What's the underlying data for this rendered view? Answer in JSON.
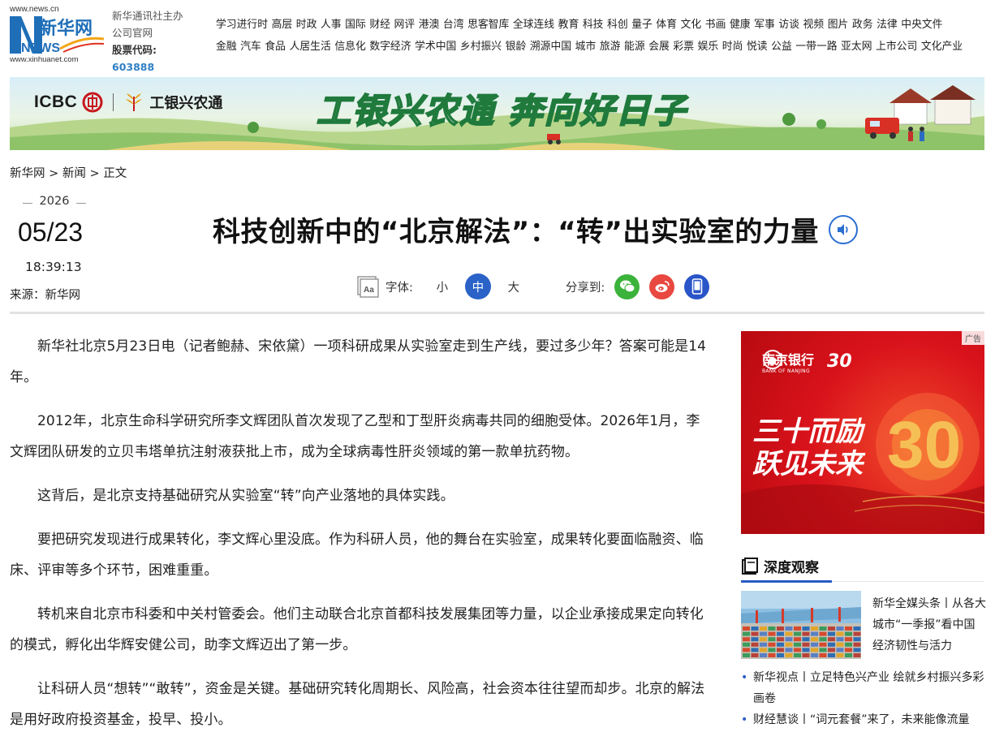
{
  "header": {
    "site_url": "www.news.cn",
    "site_url_alt": "www.xinhuanet.com",
    "logo_cn": "新华网",
    "logo_en": "NEWS",
    "host_line1": "新华通讯社主办",
    "host_line2": "公司官网",
    "stock_label": "股票代码:",
    "stock_code": "603888",
    "nav_row1": [
      "学习进行时",
      "高层",
      "时政",
      "人事",
      "国际",
      "财经",
      "网评",
      "港澳",
      "台湾",
      "思客智库",
      "全球连线",
      "教育",
      "科技",
      "科创",
      "量子",
      "体育",
      "文化",
      "书画",
      "健康",
      "军事",
      "访谈",
      "视频",
      "图片",
      "政务",
      "法律",
      "中央文件"
    ],
    "nav_row2": [
      "金融",
      "汽车",
      "食品",
      "人居生活",
      "信息化",
      "数字经济",
      "学术中国",
      "乡村振兴",
      "银龄",
      "溯源中国",
      "城市",
      "旅游",
      "能源",
      "会展",
      "彩票",
      "娱乐",
      "时尚",
      "悦读",
      "公益",
      "一带一路",
      "亚太网",
      "上市公司",
      "文化产业"
    ]
  },
  "banner": {
    "brand": "ICBC",
    "brand_cn": "工银兴农通",
    "slogan": "工银兴农通 奔向好日子"
  },
  "breadcrumb": {
    "home": "新华网",
    "sep1": " > ",
    "section": "新闻",
    "sep2": " > ",
    "current": "正文"
  },
  "meta": {
    "year": "2026",
    "monthday": "05/23",
    "time": "18:39:13",
    "source": "来源：新华网"
  },
  "article": {
    "title": "科技创新中的“北京解法”：“转”出实验室的力量",
    "font_label": "字体:",
    "font_small": "小",
    "font_medium": "中",
    "font_large": "大",
    "share_label": "分享到:",
    "paragraphs": [
      "新华社北京5月23日电（记者鲍赫、宋依黛）一项科研成果从实验室走到生产线，要过多少年？答案可能是14年。",
      "2012年，北京生命科学研究所李文辉团队首次发现了乙型和丁型肝炎病毒共同的细胞受体。2026年1月，李文辉团队研发的立贝韦塔单抗注射液获批上市，成为全球病毒性肝炎领域的第一款单抗药物。",
      "这背后，是北京支持基础研究从实验室“转”向产业落地的具体实践。",
      "要把研究发现进行成果转化，李文辉心里没底。作为科研人员，他的舞台在实验室，成果转化要面临融资、临床、评审等多个环节，困难重重。",
      "转机来自北京市科委和中关村管委会。他们主动联合北京首都科技发展集团等力量，以企业承接成果定向转化的模式，孵化出华辉安健公司，助李文辉迈出了第一步。",
      "让科研人员“想转”“敢转”，资金是关键。基础研究转化周期长、风险高，社会资本往往望而却步。北京的解法是用好政府投资基金，投早、投小。"
    ]
  },
  "sidebar": {
    "ad_tag": "广告",
    "ad_bank_cn": "南京银行",
    "ad_bank_en": "BANK OF NANJING",
    "ad_badge": "30",
    "ad_line1": "三十而励",
    "ad_line2": "跃见未来",
    "section_title": "深度观察",
    "feature_title": "新华全媒头条丨从各大城市“一季报”看中国经济韧性与活力",
    "news": [
      "新华视点丨立足特色兴产业 绘就乡村振兴多彩画卷",
      "财经慧谈丨“词元套餐”来了，未来能像流量"
    ]
  },
  "colors": {
    "accent": "#2a62c7",
    "logo_blue": "#1f6fb8",
    "wechat": "#3bb33b",
    "weibo": "#e8483f",
    "mobile": "#2a55c8",
    "ad_red": "#d9121b"
  }
}
